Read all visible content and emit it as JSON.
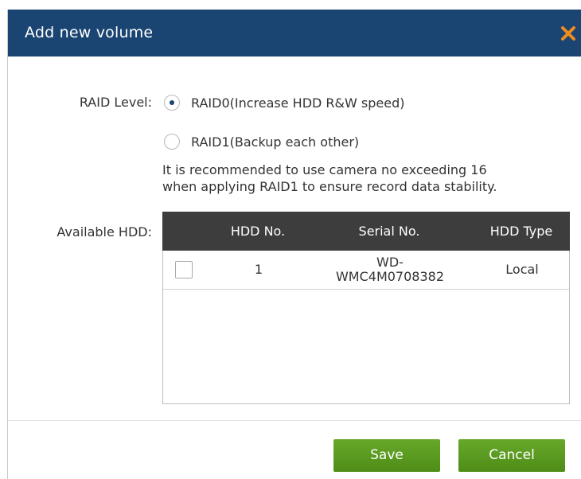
{
  "dialog": {
    "title": "Add new volume",
    "close_icon": "close-x-icon",
    "title_bar_color": "#1a4472",
    "close_color": "#f08c1e"
  },
  "form": {
    "raid_label": "RAID Level:",
    "raid_options": [
      {
        "label": "RAID0(Increase HDD R&W speed)",
        "selected": true
      },
      {
        "label": "RAID1(Backup each other)",
        "selected": false
      }
    ],
    "note_line1": "It is recommended to use camera no exceeding 16",
    "note_line2": "when applying RAID1 to ensure record data stability.",
    "hdd_label": "Available HDD:"
  },
  "hdd_table": {
    "columns": [
      "",
      "HDD No.",
      "Serial No.",
      "HDD Type"
    ],
    "rows": [
      {
        "checked": false,
        "hdd_no": "1",
        "serial_no_line1": "WD-",
        "serial_no_line2": "WMC4M0708382",
        "type": "Local"
      }
    ]
  },
  "footer": {
    "save_label": "Save",
    "cancel_label": "Cancel",
    "button_color": "#5a9a1e"
  }
}
